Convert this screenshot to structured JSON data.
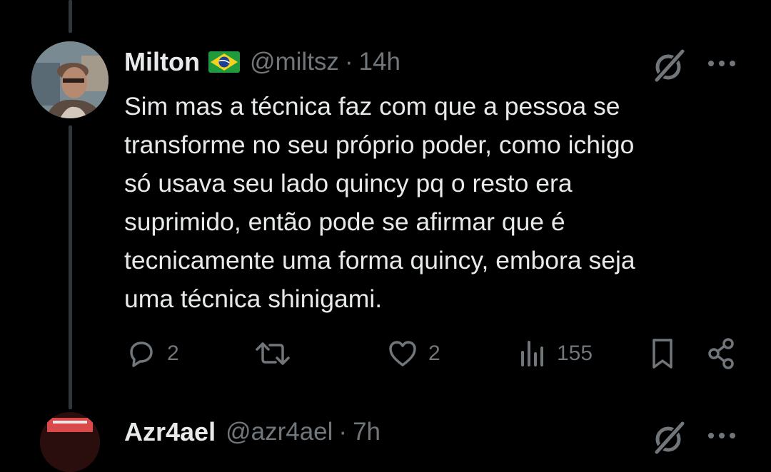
{
  "tweet": {
    "author_name": "Milton",
    "author_flag": "brazil-flag",
    "handle": "@miltsz",
    "separator": "·",
    "time": "14h",
    "text_lines": [
      "Sim mas a técnica faz com que a pessoa se",
      "transforme no seu próprio poder, como ichigo",
      "só usava seu lado quincy pq o resto era",
      "suprimido, então pode se afirmar que é",
      "tecnicamente uma forma quincy, embora seja",
      "uma técnica shinigami."
    ],
    "actions": {
      "replies": "2",
      "reposts": "",
      "likes": "2",
      "views": "155"
    },
    "icons": [
      "grok-icon",
      "more-icon",
      "reply-icon",
      "repost-icon",
      "like-icon",
      "views-icon",
      "bookmark-icon",
      "share-icon"
    ]
  },
  "next_tweet": {
    "author_name": "Azr4ael",
    "handle": "@azr4ael",
    "separator": "·",
    "time": "7h"
  },
  "colors": {
    "background": "#000000",
    "text": "#e7e9ea",
    "muted": "#71767b",
    "thread_line": "#333639"
  }
}
